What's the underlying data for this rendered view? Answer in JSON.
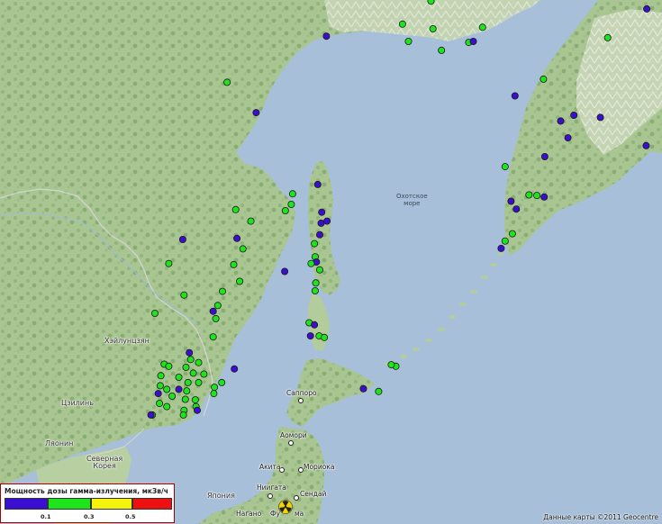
{
  "labels": {
    "okhotsk_sea": [
      "Охотское",
      "море"
    ],
    "heilongjiang": "Хэйлунцзян",
    "jilin": "Цзилинь",
    "liaoning": "Ляонин",
    "north_korea": [
      "Северная",
      "Корея"
    ],
    "japan": "Япония",
    "sapporo": "Саппоро",
    "aomori": "Аомори",
    "akita": "Акита",
    "morioka": "Мориока",
    "niigata": "Ниигата",
    "sendai": "Сендай",
    "nagano": "Нагано",
    "fukushima_partial": "Фу",
    "fukushima_partial2": "ма"
  },
  "legend": {
    "title": "Мощность дозы гамма-излучения, мкЗв/ч",
    "ticks": [
      "0.1",
      "0.3",
      "0.5"
    ],
    "colors": {
      "low": "#3b0fd0",
      "mid": "#1de41d",
      "high": "#f3f30b",
      "danger": "#ee1111"
    }
  },
  "credit": "Данные карты ©2011 Geocentre",
  "colors": {
    "sea": "#a7bfd8",
    "land": "#b7cea0",
    "forest": "#8fb27a",
    "snow": "#eef2ea"
  },
  "stations": [
    {
      "lon": 0.651,
      "lat": 0.002,
      "level": "mid"
    },
    {
      "lon": 0.608,
      "lat": 0.046,
      "level": "mid"
    },
    {
      "lon": 0.493,
      "lat": 0.069,
      "level": "low"
    },
    {
      "lon": 0.617,
      "lat": 0.079,
      "level": "mid"
    },
    {
      "lon": 0.654,
      "lat": 0.055,
      "level": "mid"
    },
    {
      "lon": 0.667,
      "lat": 0.096,
      "level": "mid"
    },
    {
      "lon": 0.708,
      "lat": 0.081,
      "level": "mid"
    },
    {
      "lon": 0.715,
      "lat": 0.079,
      "level": "low"
    },
    {
      "lon": 0.729,
      "lat": 0.052,
      "level": "mid"
    },
    {
      "lon": 0.977,
      "lat": 0.017,
      "level": "low"
    },
    {
      "lon": 0.918,
      "lat": 0.072,
      "level": "mid"
    },
    {
      "lon": 0.821,
      "lat": 0.151,
      "level": "mid"
    },
    {
      "lon": 0.778,
      "lat": 0.183,
      "level": "low"
    },
    {
      "lon": 0.867,
      "lat": 0.22,
      "level": "low"
    },
    {
      "lon": 0.907,
      "lat": 0.224,
      "level": "low"
    },
    {
      "lon": 0.847,
      "lat": 0.231,
      "level": "low"
    },
    {
      "lon": 0.858,
      "lat": 0.263,
      "level": "low"
    },
    {
      "lon": 0.976,
      "lat": 0.278,
      "level": "low"
    },
    {
      "lon": 0.343,
      "lat": 0.157,
      "level": "mid"
    },
    {
      "lon": 0.387,
      "lat": 0.215,
      "level": "low"
    },
    {
      "lon": 0.823,
      "lat": 0.299,
      "level": "low"
    },
    {
      "lon": 0.763,
      "lat": 0.318,
      "level": "mid"
    },
    {
      "lon": 0.799,
      "lat": 0.372,
      "level": "mid"
    },
    {
      "lon": 0.811,
      "lat": 0.373,
      "level": "mid"
    },
    {
      "lon": 0.822,
      "lat": 0.376,
      "level": "low"
    },
    {
      "lon": 0.772,
      "lat": 0.384,
      "level": "low"
    },
    {
      "lon": 0.78,
      "lat": 0.399,
      "level": "low"
    },
    {
      "lon": 0.774,
      "lat": 0.446,
      "level": "mid"
    },
    {
      "lon": 0.763,
      "lat": 0.46,
      "level": "mid"
    },
    {
      "lon": 0.757,
      "lat": 0.474,
      "level": "low"
    },
    {
      "lon": 0.48,
      "lat": 0.352,
      "level": "low"
    },
    {
      "lon": 0.442,
      "lat": 0.37,
      "level": "mid"
    },
    {
      "lon": 0.486,
      "lat": 0.405,
      "level": "low"
    },
    {
      "lon": 0.431,
      "lat": 0.402,
      "level": "mid"
    },
    {
      "lon": 0.44,
      "lat": 0.39,
      "level": "mid"
    },
    {
      "lon": 0.356,
      "lat": 0.4,
      "level": "mid"
    },
    {
      "lon": 0.379,
      "lat": 0.422,
      "level": "mid"
    },
    {
      "lon": 0.276,
      "lat": 0.457,
      "level": "low"
    },
    {
      "lon": 0.358,
      "lat": 0.455,
      "level": "low"
    },
    {
      "lon": 0.367,
      "lat": 0.475,
      "level": "mid"
    },
    {
      "lon": 0.485,
      "lat": 0.426,
      "level": "low"
    },
    {
      "lon": 0.494,
      "lat": 0.422,
      "level": "low"
    },
    {
      "lon": 0.483,
      "lat": 0.448,
      "level": "low"
    },
    {
      "lon": 0.475,
      "lat": 0.465,
      "level": "mid"
    },
    {
      "lon": 0.476,
      "lat": 0.49,
      "level": "mid"
    },
    {
      "lon": 0.478,
      "lat": 0.5,
      "level": "low"
    },
    {
      "lon": 0.47,
      "lat": 0.503,
      "level": "mid"
    },
    {
      "lon": 0.483,
      "lat": 0.515,
      "level": "mid"
    },
    {
      "lon": 0.477,
      "lat": 0.54,
      "level": "mid"
    },
    {
      "lon": 0.255,
      "lat": 0.503,
      "level": "mid"
    },
    {
      "lon": 0.353,
      "lat": 0.505,
      "level": "mid"
    },
    {
      "lon": 0.43,
      "lat": 0.518,
      "level": "low"
    },
    {
      "lon": 0.336,
      "lat": 0.556,
      "level": "mid"
    },
    {
      "lon": 0.362,
      "lat": 0.537,
      "level": "mid"
    },
    {
      "lon": 0.329,
      "lat": 0.583,
      "level": "mid"
    },
    {
      "lon": 0.476,
      "lat": 0.555,
      "level": "mid"
    },
    {
      "lon": 0.278,
      "lat": 0.563,
      "level": "mid"
    },
    {
      "lon": 0.322,
      "lat": 0.594,
      "level": "low"
    },
    {
      "lon": 0.326,
      "lat": 0.608,
      "level": "mid"
    },
    {
      "lon": 0.234,
      "lat": 0.598,
      "level": "mid"
    },
    {
      "lon": 0.322,
      "lat": 0.643,
      "level": "mid"
    },
    {
      "lon": 0.288,
      "lat": 0.686,
      "level": "mid"
    },
    {
      "lon": 0.467,
      "lat": 0.616,
      "level": "mid"
    },
    {
      "lon": 0.475,
      "lat": 0.62,
      "level": "low"
    },
    {
      "lon": 0.469,
      "lat": 0.641,
      "level": "low"
    },
    {
      "lon": 0.482,
      "lat": 0.641,
      "level": "mid"
    },
    {
      "lon": 0.49,
      "lat": 0.644,
      "level": "mid"
    },
    {
      "lon": 0.286,
      "lat": 0.673,
      "level": "low"
    },
    {
      "lon": 0.248,
      "lat": 0.695,
      "level": "mid"
    },
    {
      "lon": 0.255,
      "lat": 0.699,
      "level": "mid"
    },
    {
      "lon": 0.3,
      "lat": 0.692,
      "level": "mid"
    },
    {
      "lon": 0.281,
      "lat": 0.701,
      "level": "mid"
    },
    {
      "lon": 0.292,
      "lat": 0.712,
      "level": "mid"
    },
    {
      "lon": 0.308,
      "lat": 0.714,
      "level": "mid"
    },
    {
      "lon": 0.354,
      "lat": 0.704,
      "level": "low"
    },
    {
      "lon": 0.243,
      "lat": 0.717,
      "level": "mid"
    },
    {
      "lon": 0.27,
      "lat": 0.72,
      "level": "mid"
    },
    {
      "lon": 0.284,
      "lat": 0.73,
      "level": "mid"
    },
    {
      "lon": 0.3,
      "lat": 0.73,
      "level": "mid"
    },
    {
      "lon": 0.335,
      "lat": 0.73,
      "level": "mid"
    },
    {
      "lon": 0.324,
      "lat": 0.739,
      "level": "mid"
    },
    {
      "lon": 0.323,
      "lat": 0.751,
      "level": "mid"
    },
    {
      "lon": 0.242,
      "lat": 0.736,
      "level": "mid"
    },
    {
      "lon": 0.252,
      "lat": 0.743,
      "level": "mid"
    },
    {
      "lon": 0.27,
      "lat": 0.743,
      "level": "low"
    },
    {
      "lon": 0.282,
      "lat": 0.746,
      "level": "mid"
    },
    {
      "lon": 0.239,
      "lat": 0.751,
      "level": "low"
    },
    {
      "lon": 0.26,
      "lat": 0.756,
      "level": "mid"
    },
    {
      "lon": 0.28,
      "lat": 0.762,
      "level": "mid"
    },
    {
      "lon": 0.295,
      "lat": 0.763,
      "level": "mid"
    },
    {
      "lon": 0.241,
      "lat": 0.77,
      "level": "mid"
    },
    {
      "lon": 0.252,
      "lat": 0.776,
      "level": "mid"
    },
    {
      "lon": 0.296,
      "lat": 0.776,
      "level": "mid"
    },
    {
      "lon": 0.23,
      "lat": 0.792,
      "level": "mid"
    },
    {
      "lon": 0.278,
      "lat": 0.783,
      "level": "mid"
    },
    {
      "lon": 0.298,
      "lat": 0.783,
      "level": "low"
    },
    {
      "lon": 0.228,
      "lat": 0.792,
      "level": "low"
    },
    {
      "lon": 0.277,
      "lat": 0.792,
      "level": "mid"
    },
    {
      "lon": 0.598,
      "lat": 0.699,
      "level": "mid"
    },
    {
      "lon": 0.591,
      "lat": 0.696,
      "level": "mid"
    },
    {
      "lon": 0.549,
      "lat": 0.742,
      "level": "low"
    },
    {
      "lon": 0.572,
      "lat": 0.747,
      "level": "mid"
    }
  ]
}
